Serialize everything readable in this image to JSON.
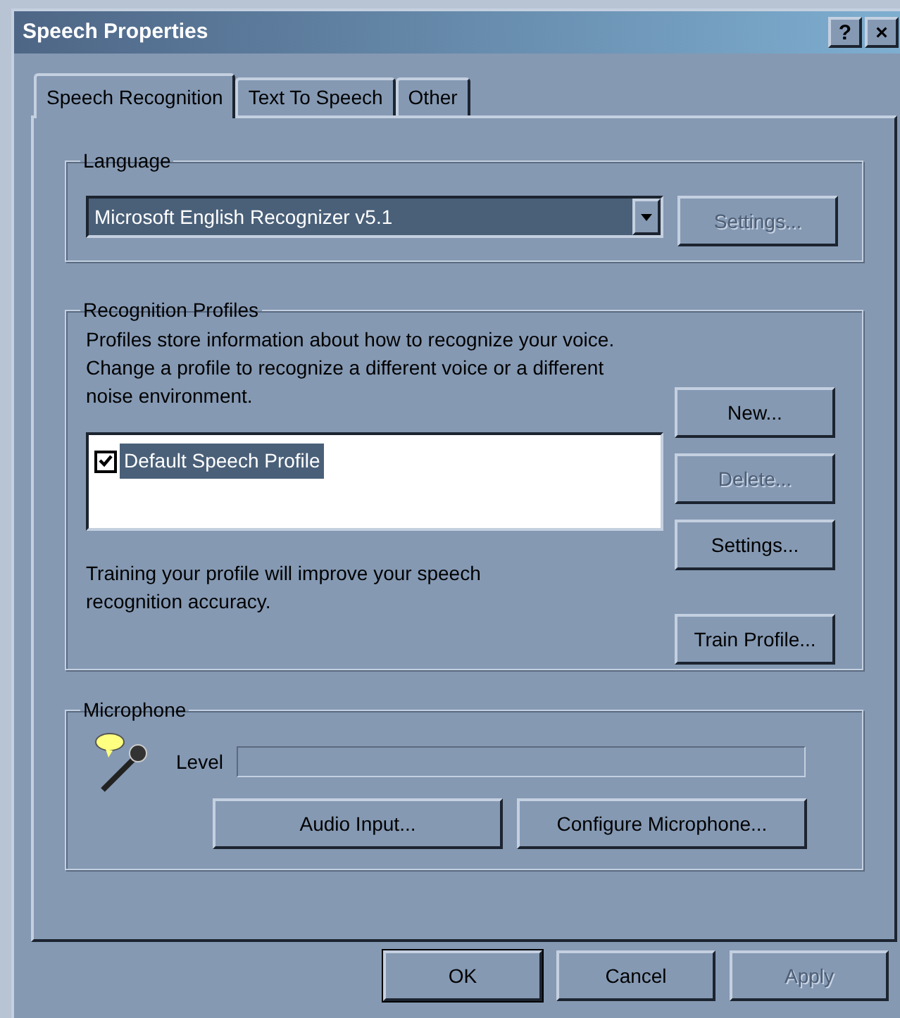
{
  "window": {
    "title": "Speech Properties",
    "title_buttons": [
      "?",
      "×"
    ]
  },
  "tabs": [
    {
      "label": "Speech Recognition",
      "selected": true
    },
    {
      "label": "Text To Speech",
      "selected": false
    },
    {
      "label": "Other",
      "selected": false
    }
  ],
  "language": {
    "legend": "Language",
    "value": "Microsoft English Recognizer v5.1",
    "settings_button": {
      "label": "Settings...",
      "disabled": true
    }
  },
  "profiles": {
    "legend": "Recognition Profiles",
    "description": "Profiles store information about how to recognize your voice.  Change a profile to recognize a different voice or a different noise environment.",
    "items": [
      {
        "label": "Default Speech Profile",
        "checked": true,
        "selected": true
      }
    ],
    "buttons": [
      {
        "label": "New...",
        "disabled": false
      },
      {
        "label": "Delete...",
        "disabled": true
      },
      {
        "label": "Settings...",
        "disabled": false
      }
    ],
    "training_text": "Training your profile will improve your speech recognition accuracy.",
    "train_button": {
      "label": "Train Profile...",
      "disabled": false
    }
  },
  "microphone": {
    "legend": "Microphone",
    "level_label": "Level",
    "level": 0,
    "buttons": [
      {
        "label": "Audio Input...",
        "disabled": false
      },
      {
        "label": "Configure Microphone...",
        "disabled": false
      }
    ]
  },
  "buttons": [
    {
      "label": "OK",
      "disabled": false,
      "default": true
    },
    {
      "label": "Cancel",
      "disabled": false,
      "default": false
    },
    {
      "label": "Apply",
      "disabled": true,
      "default": false
    }
  ]
}
